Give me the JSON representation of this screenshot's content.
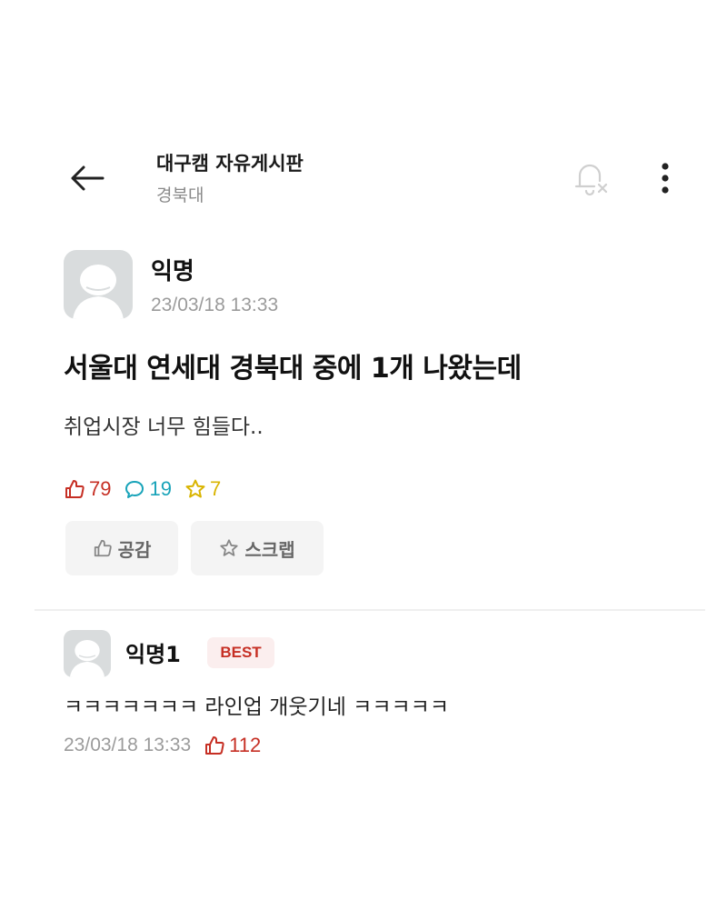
{
  "header": {
    "board_title": "대구캠 자유게시판",
    "board_subtitle": "경북대",
    "back_icon": "arrow-left-icon",
    "notification_icon": "bell-off-icon",
    "more_icon": "more-vertical-icon"
  },
  "post": {
    "author": "익명",
    "date": "23/03/18 13:33",
    "title": "서울대 연세대 경북대 중에 1개 나왔는데",
    "body": "취업시장 너무 힘들다..",
    "stats": {
      "likes": "79",
      "comments": "19",
      "scraps": "7"
    },
    "actions": {
      "like_label": "공감",
      "scrap_label": "스크랩"
    }
  },
  "comments": [
    {
      "author": "익명1",
      "badge": "BEST",
      "body": "ㅋㅋㅋㅋㅋㅋㅋ 라인업 개웃기네 ㅋㅋㅋㅋㅋ",
      "date": "23/03/18 13:33",
      "likes": "112"
    }
  ],
  "colors": {
    "like": "#c62f24",
    "comment": "#18a3b9",
    "scrap": "#d9b400",
    "muted": "#9b9b9b",
    "best_bg": "#fbeeee"
  }
}
